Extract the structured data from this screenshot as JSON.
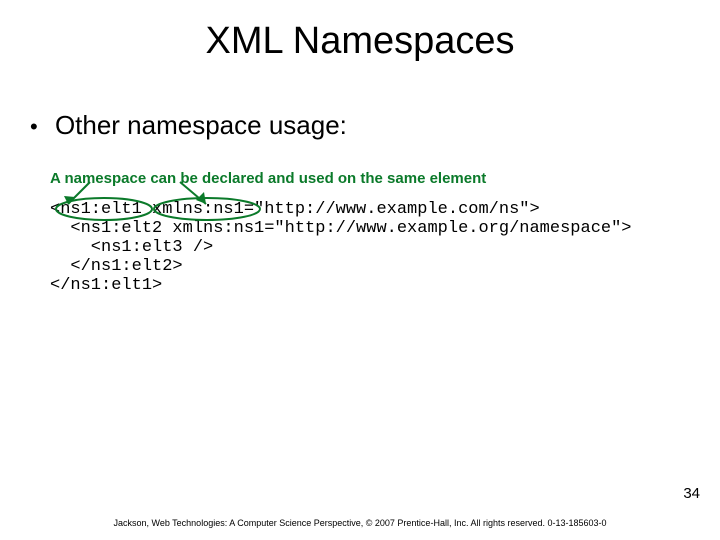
{
  "title": "XML Namespaces",
  "bullet": "Other namespace usage:",
  "note": "A namespace can be declared and used on the same element",
  "code": {
    "l1": "<ns1:elt1 xmlns:ns1=\"http://www.example.com/ns\">",
    "l2": "  <ns1:elt2 xmlns:ns1=\"http://www.example.org/namespace\">",
    "l3": "    <ns1:elt3 />",
    "l4": "  </ns1:elt2>",
    "l5": "</ns1:elt1>"
  },
  "page_number": "34",
  "footer": "Jackson, Web Technologies: A Computer Science Perspective, © 2007 Prentice-Hall, Inc. All rights reserved. 0-13-185603-0"
}
